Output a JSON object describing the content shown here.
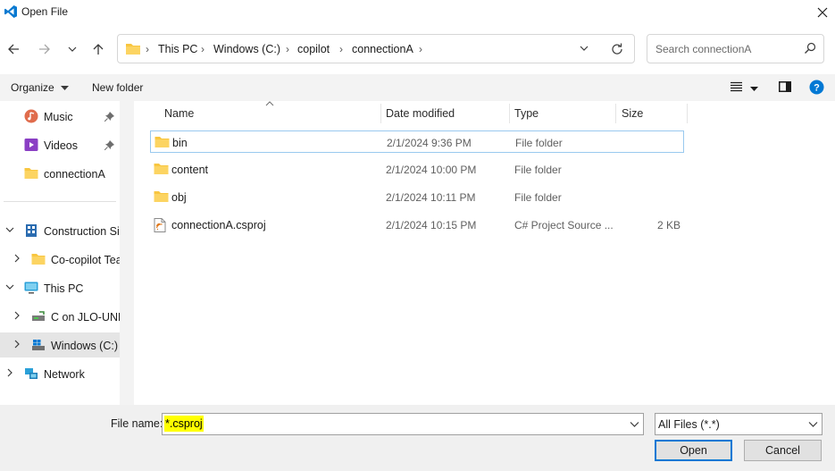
{
  "window": {
    "title": "Open File"
  },
  "address": {
    "breadcrumbs": [
      "This PC",
      "Windows (C:)",
      "copilot",
      "connectionA"
    ]
  },
  "search": {
    "placeholder": "Search connectionA"
  },
  "toolbar": {
    "organize_label": "Organize",
    "new_folder_label": "New folder"
  },
  "nav": {
    "items": [
      {
        "label": "Music",
        "icon": "music-icon",
        "pinned": true
      },
      {
        "label": "Videos",
        "icon": "videos-icon",
        "pinned": true
      },
      {
        "label": "connectionA",
        "icon": "folder-icon"
      },
      {
        "label": "Construction Site",
        "icon": "building-icon",
        "expanded": true
      },
      {
        "label": "Co-copilot Team",
        "icon": "folder-icon"
      },
      {
        "label": "This PC",
        "icon": "computer-icon",
        "expanded": true
      },
      {
        "label": "C on JLO-UNM",
        "icon": "network-drive-icon"
      },
      {
        "label": "Windows (C:)",
        "icon": "drive-icon",
        "selected": true
      },
      {
        "label": "Network",
        "icon": "network-icon"
      }
    ]
  },
  "columns": [
    "Name",
    "Date modified",
    "Type",
    "Size"
  ],
  "files": [
    {
      "name": "bin",
      "date": "2/1/2024 9:36 PM",
      "type": "File folder",
      "size": "",
      "icon": "folder-icon",
      "selected": true
    },
    {
      "name": "content",
      "date": "2/1/2024 10:00 PM",
      "type": "File folder",
      "size": "",
      "icon": "folder-icon"
    },
    {
      "name": "obj",
      "date": "2/1/2024 10:11 PM",
      "type": "File folder",
      "size": "",
      "icon": "folder-icon"
    },
    {
      "name": "connectionA.csproj",
      "date": "2/1/2024 10:15 PM",
      "type": "C# Project Source ...",
      "size": "2 KB",
      "icon": "csproj-file-icon"
    }
  ],
  "bottom": {
    "file_name_label": "File name:",
    "file_name_value": "*.csproj",
    "file_type_value": "All Files (*.*)",
    "open_label": "Open",
    "cancel_label": "Cancel"
  },
  "colors": {
    "accent": "#0078d4",
    "folder": "#f8c640",
    "highlight": "#ffff00"
  }
}
